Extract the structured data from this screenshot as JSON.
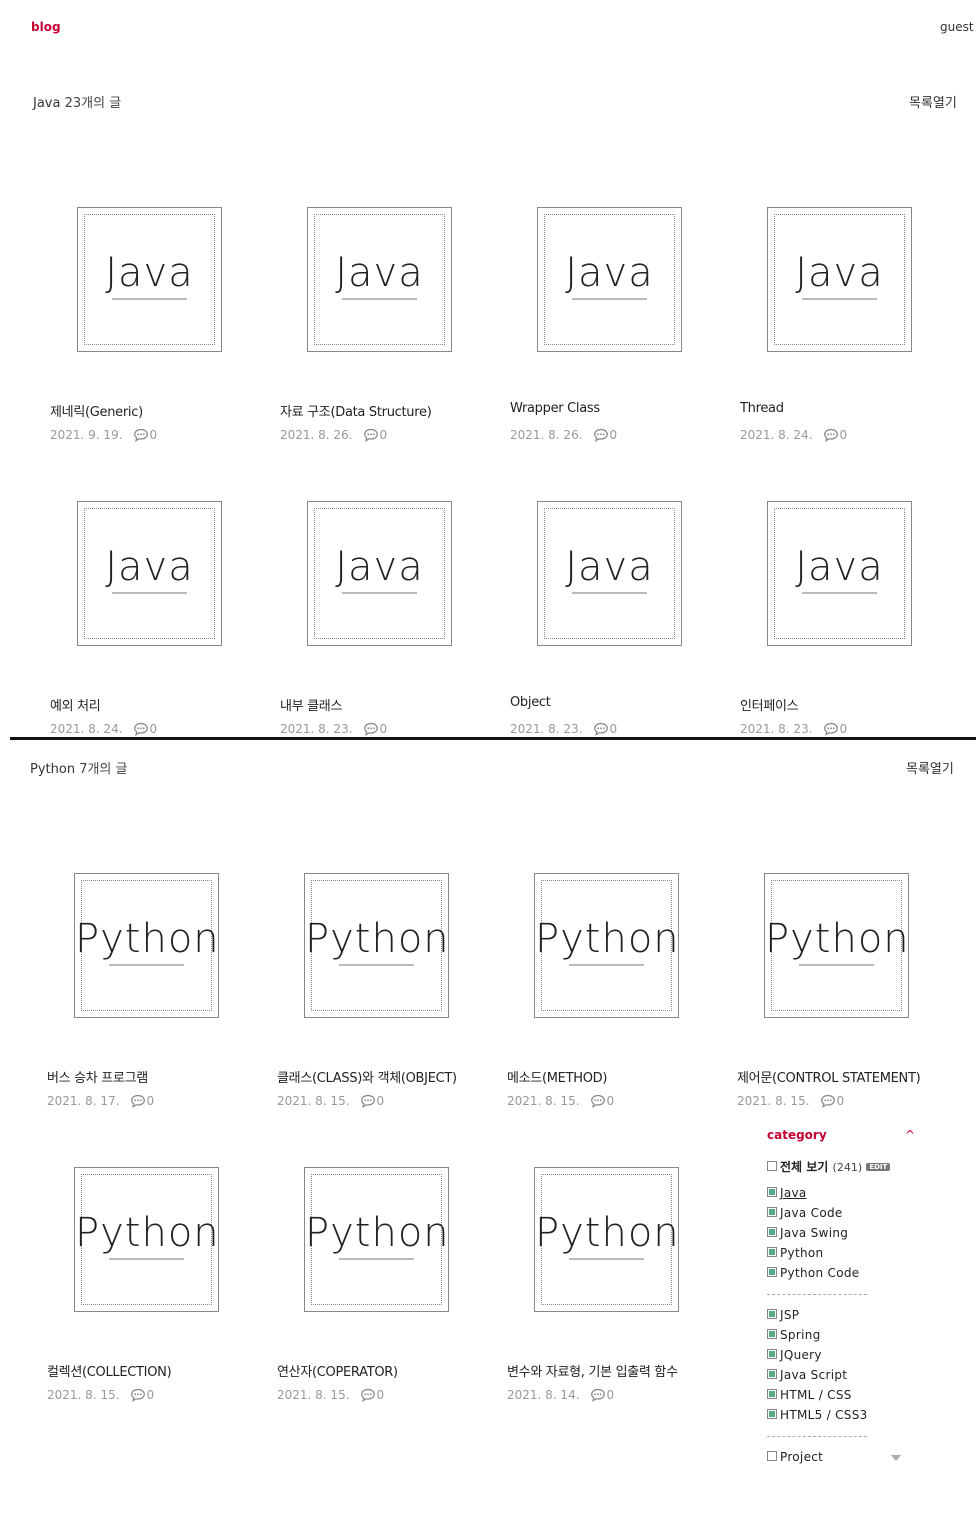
{
  "header": {
    "blog": "blog",
    "user": "guest"
  },
  "sections": [
    {
      "name": "Java",
      "count": "23개의 글",
      "toggle": "목록열기",
      "thumb": "Java",
      "posts": [
        {
          "title": "제네릭(Generic)",
          "date": "2021. 9. 19.",
          "comments": "0"
        },
        {
          "title": "자료 구조(Data Structure)",
          "date": "2021. 8. 26.",
          "comments": "0"
        },
        {
          "title": "Wrapper Class",
          "date": "2021. 8. 26.",
          "comments": "0"
        },
        {
          "title": "Thread",
          "date": "2021. 8. 24.",
          "comments": "0"
        },
        {
          "title": "예외 처리",
          "date": "2021. 8. 24.",
          "comments": "0"
        },
        {
          "title": "내부 클래스",
          "date": "2021. 8. 23.",
          "comments": "0"
        },
        {
          "title": "Object",
          "date": "2021. 8. 23.",
          "comments": "0"
        },
        {
          "title": "인터페이스",
          "date": "2021. 8. 23.",
          "comments": "0"
        }
      ]
    },
    {
      "name": "Python",
      "count": "7개의 글",
      "toggle": "목록열기",
      "thumb": "Python",
      "posts": [
        {
          "title": "버스 승차 프로그램",
          "date": "2021. 8. 17.",
          "comments": "0"
        },
        {
          "title": "클래스(CLASS)와 객체(OBJECT)",
          "date": "2021. 8. 15.",
          "comments": "0"
        },
        {
          "title": "메소드(METHOD)",
          "date": "2021. 8. 15.",
          "comments": "0"
        },
        {
          "title": "제어문(CONTROL STATEMENT)",
          "date": "2021. 8. 15.",
          "comments": "0"
        },
        {
          "title": "컬렉션(COLLECTION)",
          "date": "2021. 8. 15.",
          "comments": "0"
        },
        {
          "title": "연산자(COPERATOR)",
          "date": "2021. 8. 15.",
          "comments": "0"
        },
        {
          "title": "변수와 자료형, 기본 입출력 함수",
          "date": "2021. 8. 14.",
          "comments": "0"
        }
      ]
    }
  ],
  "category": {
    "title": "category",
    "caret": "^",
    "all_label": "전체 보기",
    "all_count": "(241)",
    "edit": "EDIT",
    "group1": [
      "Java",
      "Java Code",
      "Java Swing",
      "Python",
      "Python Code"
    ],
    "group2": [
      "JSP",
      "Spring",
      "JQuery",
      "Java Script",
      "HTML / CSS",
      "HTML5 / CSS3"
    ],
    "project": "Project"
  },
  "colors": {
    "accent": "#c40033",
    "checkbox": "#55aa88"
  }
}
